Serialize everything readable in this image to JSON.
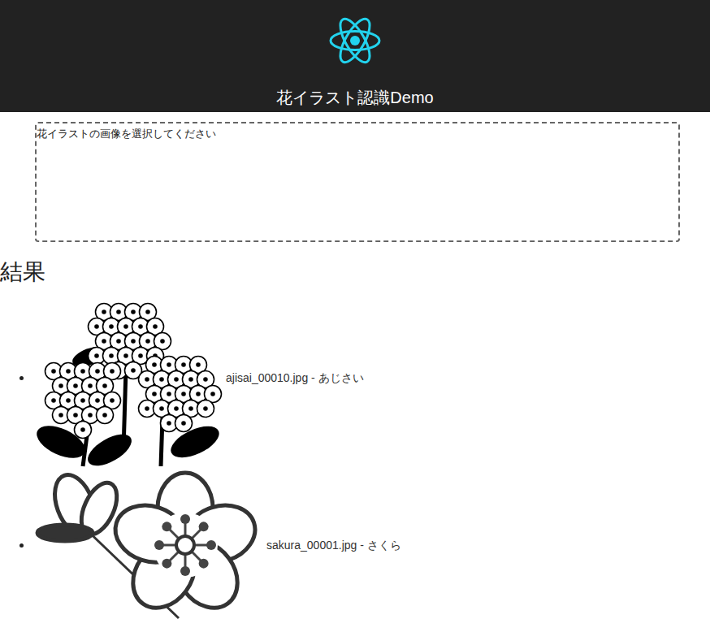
{
  "header": {
    "title": "花イラスト認識Demo"
  },
  "dropzone": {
    "text": "花イラストの画像を選択してください"
  },
  "results": {
    "heading": "結果",
    "items": [
      {
        "text": "ajisai_00010.jpg - あじさい",
        "kind": "hydrangea"
      },
      {
        "text": "sakura_00001.jpg - さくら",
        "kind": "cherry"
      }
    ]
  }
}
